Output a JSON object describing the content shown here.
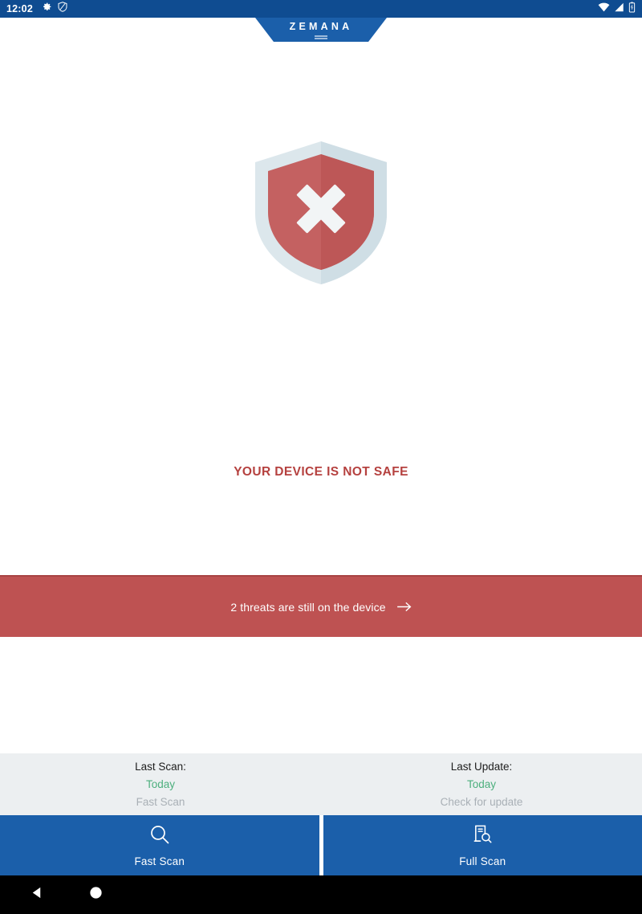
{
  "statusbar": {
    "time": "12:02",
    "left_icons": [
      "gear-icon",
      "zemana-shield-icon"
    ],
    "right_icons": [
      "wifi-icon",
      "signal-icon",
      "battery-icon"
    ],
    "background_color": "#0F4C91"
  },
  "header": {
    "brand": "ZEMANA",
    "tab_color": "#1B5FAA"
  },
  "status": {
    "shield_icon": "shield-x-icon",
    "shield_body_color": "#BE5B5B",
    "shield_border_color": "#D6E2E8",
    "headline": "YOUR DEVICE IS NOT SAFE",
    "headline_color": "#B5413F"
  },
  "threat_banner": {
    "text": "2 threats are still on the device",
    "arrow_icon": "arrow-right-icon",
    "background_color": "#BE5252"
  },
  "infobar": {
    "background_color": "#ECEFF1",
    "columns": [
      {
        "title": "Last Scan:",
        "value": "Today",
        "action": "Fast Scan"
      },
      {
        "title": "Last Update:",
        "value": "Today",
        "action": "Check for update"
      }
    ],
    "value_color": "#4CAF7D",
    "action_color": "#A9B0B6"
  },
  "actions": {
    "background_color": "#1B5FAA",
    "buttons": [
      {
        "label": "Fast Scan",
        "icon": "magnifier-icon"
      },
      {
        "label": "Full Scan",
        "icon": "document-search-icon"
      }
    ]
  },
  "navbar": {
    "back_icon": "back-triangle-icon",
    "home_icon": "home-circle-icon",
    "background_color": "#000000"
  }
}
